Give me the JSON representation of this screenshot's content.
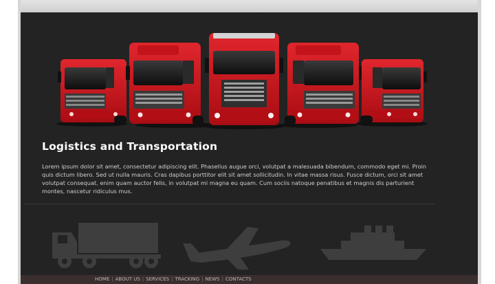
{
  "content": {
    "title": "Logistics and Transportation",
    "paragraph": "Lorem ipsum dolor sit amet, consectetur adipiscing elit. Phasellus augue orci, volutpat a malesuada bibendum, commodo eget mi. Proin quis dictum libero. Sed ut nulla mauris. Cras dapibus porttitor elit sit amet sollicitudin. In vitae massa risus. Fusce dictum, orci sit amet volutpat consequat, enim quam auctor felis, in volutpat mi magna eu quam. Cum sociis natoque penatibus et magnis dis parturient montes, nascetur ridiculus mus."
  },
  "hero": {
    "image": "red-trucks-lineup",
    "truck_color": "#c4141b"
  },
  "services": {
    "icons": [
      "truck-icon",
      "airplane-icon",
      "ship-icon"
    ],
    "icon_color": "#3e3e3e"
  },
  "footer": {
    "nav": [
      "HOME",
      "ABOUT US",
      "SERVICES",
      "TRACKING",
      "NEWS",
      "CONTACTS"
    ]
  },
  "colors": {
    "page_background": "#232323",
    "footer_background": "#3b2e2e",
    "text": "#d0d0d0",
    "title": "#ffffff"
  }
}
